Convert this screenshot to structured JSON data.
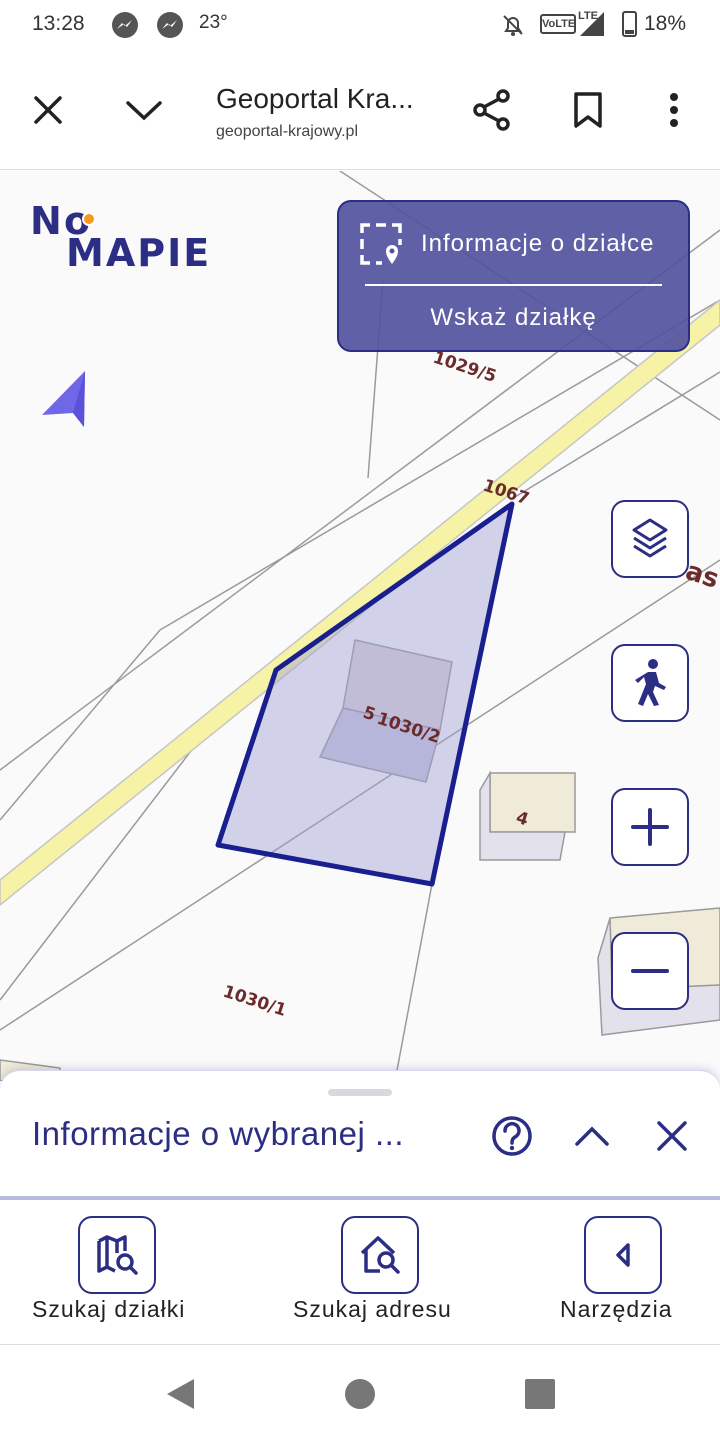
{
  "status_bar": {
    "time": "13:28",
    "temperature": "23°",
    "network": "VoLTE",
    "network_type": "LTE",
    "battery": "18%",
    "icons": [
      "messenger-icon",
      "messenger-icon",
      "bell-off-icon",
      "signal-icon",
      "battery-icon"
    ]
  },
  "browser": {
    "title": "Geoportal Kra...",
    "url": "geoportal-krajowy.pl",
    "icons": [
      "close-icon",
      "chevron-down-icon",
      "share-icon",
      "bookmark-icon",
      "more-vert-icon"
    ]
  },
  "map": {
    "logo": "NA MAPIE",
    "info_panel": {
      "title": "Informacje o działce",
      "action": "Wskaż działkę"
    },
    "parcel_labels": {
      "p1": "1029/5",
      "p2": "1067",
      "p3": "1030/2",
      "p3_prefix": "5",
      "p4": "4",
      "p5": "1030/1",
      "p6": "as"
    },
    "controls": [
      "layers-icon",
      "pedestrian-icon",
      "zoom-in-icon",
      "zoom-out-icon"
    ],
    "colors": {
      "road": "#f6f3a6",
      "parcel_outline": "#1a1f8f",
      "parcel_fill": "#d3d3ec",
      "building": "#dcd6d6"
    }
  },
  "sheet": {
    "title": "Informacje o wybranej ..."
  },
  "bottom_nav": {
    "items": [
      {
        "label": "Szukaj działki",
        "icon": "map-search-icon"
      },
      {
        "label": "Szukaj adresu",
        "icon": "home-search-icon"
      },
      {
        "label": "Narzędzia",
        "icon": "chevron-left-icon"
      }
    ]
  },
  "accent_color": "#2b2e83"
}
